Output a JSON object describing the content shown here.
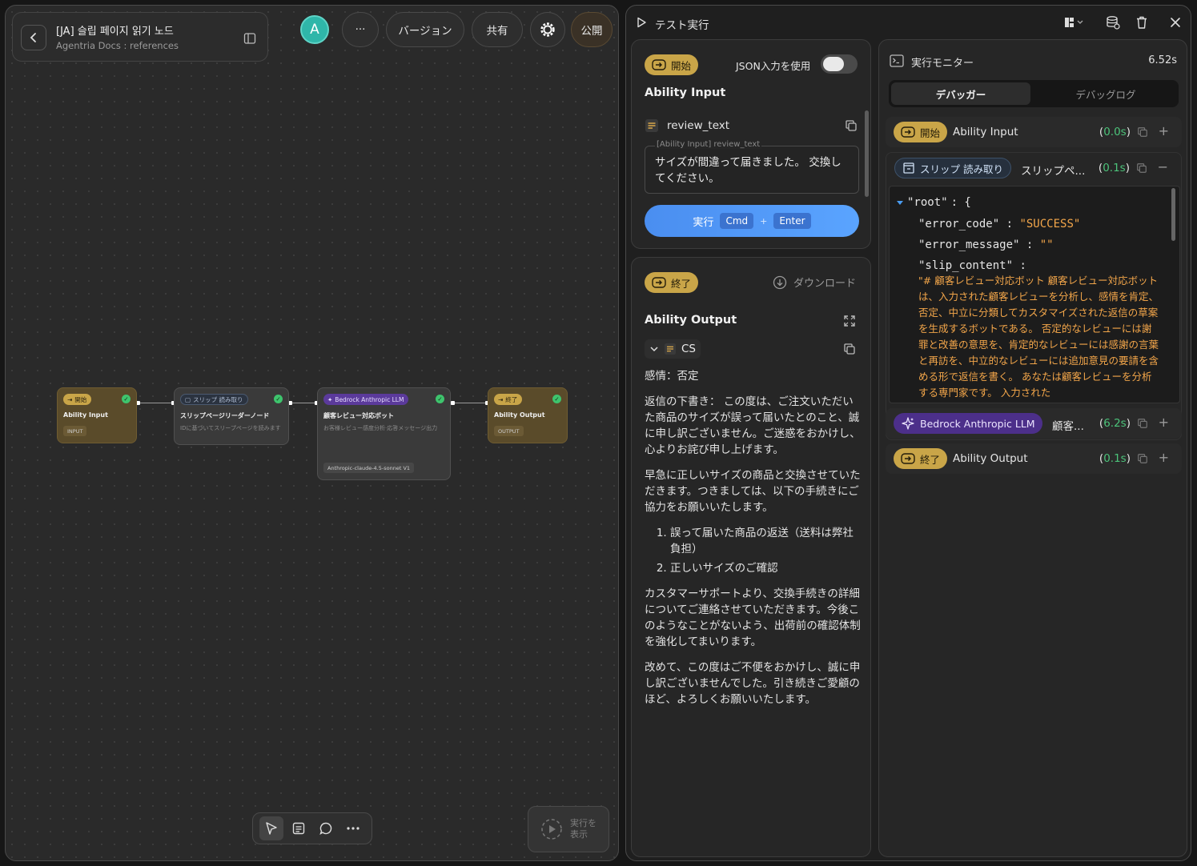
{
  "canvas": {
    "doc_title": "[JA] 슬립 페이지 읽기 노드",
    "doc_subtitle": "Agentria Docs : references",
    "avatar_letter": "A",
    "more_label": "···",
    "version_label": "バージョン",
    "share_label": "共有",
    "publish_label": "公開",
    "run_show_label_1": "実行を",
    "run_show_label_2": "表示",
    "nodes": [
      {
        "badge": "開始",
        "title": "Ability Input",
        "desc": "",
        "tag": "INPUT"
      },
      {
        "badge": "スリップ 読み取り",
        "title": "スリップページリーダーノード",
        "desc": "IDに基づいてスリープページを読みます",
        "tag": ""
      },
      {
        "badge": "Bedrock Anthropic LLM",
        "title": "顧客レビュー対応ボット",
        "desc": "お客様レビュー感度分析·応答メッセージ出力",
        "tag": "Anthropic-claude-4.5-sonnet V1"
      },
      {
        "badge": "終了",
        "title": "Ability Output",
        "desc": "",
        "tag": "OUTPUT"
      }
    ]
  },
  "panel": {
    "title": "テスト実行"
  },
  "input_card": {
    "start_label": "開始",
    "json_toggle_label": "JSON入力を使用",
    "title": "Ability Input",
    "field_name": "review_text",
    "field_legend": "[Ability Input] review_text",
    "field_value": "サイズが間違って届きました。 交換してください。",
    "run_label": "実行",
    "kbd_cmd": "Cmd",
    "kbd_plus": "+",
    "kbd_enter": "Enter"
  },
  "output_card": {
    "end_label": "終了",
    "download_label": "ダウンロード",
    "title": "Ability Output",
    "field_name": "CS",
    "emotion": "感情：否定",
    "para1": "返信の下書き： この度は、ご注文いただいた商品のサイズが誤って届いたとのこと、誠に申し訳ございません。ご迷惑をおかけし、心よりお詫び申し上げます。",
    "para2": "早急に正しいサイズの商品と交換させていただきます。つきましては、以下の手続きにご協力をお願いいたします。",
    "list": [
      "誤って届いた商品の返送（送料は弊社負担）",
      "正しいサイズのご確認"
    ],
    "para3": "カスタマーサポートより、交換手続きの詳細についてご連絡させていただきます。今後このようなことがないよう、出荷前の確認体制を強化してまいります。",
    "para4": "改めて、この度はご不便をおかけし、誠に申し訳ございませんでした。引き続きご愛顧のほど、よろしくお願いいたします。"
  },
  "monitor": {
    "title": "実行モニター",
    "elapsed": "6.52s",
    "tab_debugger": "デバッガー",
    "tab_log": "デバッグログ",
    "rows": [
      {
        "badge": "開始",
        "name": "Ability Input",
        "time": "0.0s",
        "action": "+"
      },
      {
        "badge": "スリップ 読み取り",
        "name": "スリップペ...",
        "time": "0.1s",
        "action": "−"
      },
      {
        "badge": "Bedrock Anthropic LLM",
        "name": "顧客...",
        "time": "6.2s",
        "action": "+"
      },
      {
        "badge": "終了",
        "name": "Ability Output",
        "time": "0.1s",
        "action": "+"
      }
    ],
    "json": {
      "root_key": "\"root\"",
      "error_code_key": "\"error_code\"",
      "error_code_val": "\"SUCCESS\"",
      "error_message_key": "\"error_message\"",
      "error_message_val": "\"\"",
      "slip_content_key": "\"slip_content\"",
      "slip_content_val": "\"# 顧客レビュー対応ボット 顧客レビュー対応ボットは、入力された顧客レビューを分析し、感情を肯定、否定、中立に分類してカスタマイズされた返信の草案を生成するボットである。 否定的なレビューには謝罪と改善の意思を、肯定的なレビューには感謝の言葉と再訪を、中立的なレビューには追加意見の要請を含める形で返信を書く。 あなたは顧客レビューを分析する専門家です。 入力された"
    }
  }
}
